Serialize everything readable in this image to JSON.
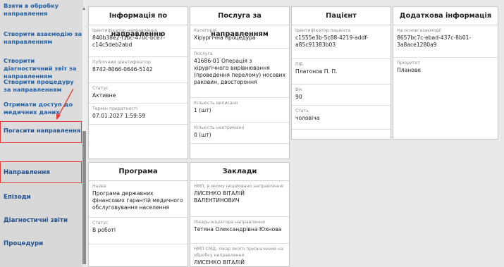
{
  "sidebar": {
    "items": [
      {
        "label": "Взяти в обробку направлення"
      },
      {
        "label": "Створити взаємодію за направленням"
      },
      {
        "label": "Створити діагностичний звіт за направленням"
      },
      {
        "label": "Створити процедуру за направленням"
      },
      {
        "label": "Отримати доступ до медичних даних"
      },
      {
        "label": "Погасити направлення"
      }
    ],
    "nav": [
      {
        "label": "Направлення"
      },
      {
        "label": "Епізоди"
      },
      {
        "label": "Діагностичні звіти"
      },
      {
        "label": "Процедури"
      }
    ]
  },
  "cards": {
    "referral": {
      "title": "Інформація по направленню",
      "fields": [
        {
          "label": "Ідентифікатор направлення",
          "value": "840b38e2-f1bc-470c-bce7-c14c5deb2abd"
        },
        {
          "label": "Публічний ідентифікатор",
          "value": "8742-8066-0646-5142"
        },
        {
          "label": "Статус",
          "value": "Активне"
        },
        {
          "label": "Термін придатності",
          "value": "07.01.2027 1:59:59"
        }
      ]
    },
    "service": {
      "title": "Послуга за направленням",
      "fields": [
        {
          "label": "Категорія",
          "value": "Хірургічна процедура"
        },
        {
          "label": "Послуга",
          "value": "41686-01 Операція з хірургічного вирівнювання (проведення переломy) носових раковин, двостороння"
        },
        {
          "label": "Кількість виписано",
          "value": "1 (шт)"
        },
        {
          "label": "Кількість неотримано",
          "value": "0 (шт)"
        }
      ]
    },
    "patient": {
      "title": "Пацієнт",
      "fields": [
        {
          "label": "Ідентифікатор пацієнта",
          "value": "c1555e3b-5c88-4219-addf-a85c91383b03"
        },
        {
          "label": "ПІБ",
          "value": "Платонов П. П."
        },
        {
          "label": "Вік",
          "value": "90"
        },
        {
          "label": "Стать",
          "value": "чоловіча"
        }
      ]
    },
    "extra": {
      "title": "Додаткова інформація",
      "fields": [
        {
          "label": "На основі взаємодії",
          "value": "8657bc7c-ebad-437c-8b01-3a8ace1280a9"
        },
        {
          "label": "Пріоритет",
          "value": "Планове"
        }
      ]
    },
    "program": {
      "title": "Програма",
      "fields": [
        {
          "label": "Назва",
          "value": "Програма державних фінансових гарантій медичного обслуговування населення"
        },
        {
          "label": "Статус",
          "value": "В роботі"
        }
      ]
    },
    "facilities": {
      "title": "Заклади",
      "fields": [
        {
          "label": "НМП, в якому ініційовано направлення",
          "value": "ЛИСЕНКО ВІТАЛІЙ ВАЛЕНТИНОВИЧ"
        },
        {
          "label": "Лікарь-ініціатора направлення",
          "value": "Тетяна Олександрівна Юхнова"
        },
        {
          "label": "НМП СМД, лікар якого призначений на обробку направлення",
          "value": "ЛИСЕНКО ВІТАЛІЙ"
        }
      ]
    }
  }
}
